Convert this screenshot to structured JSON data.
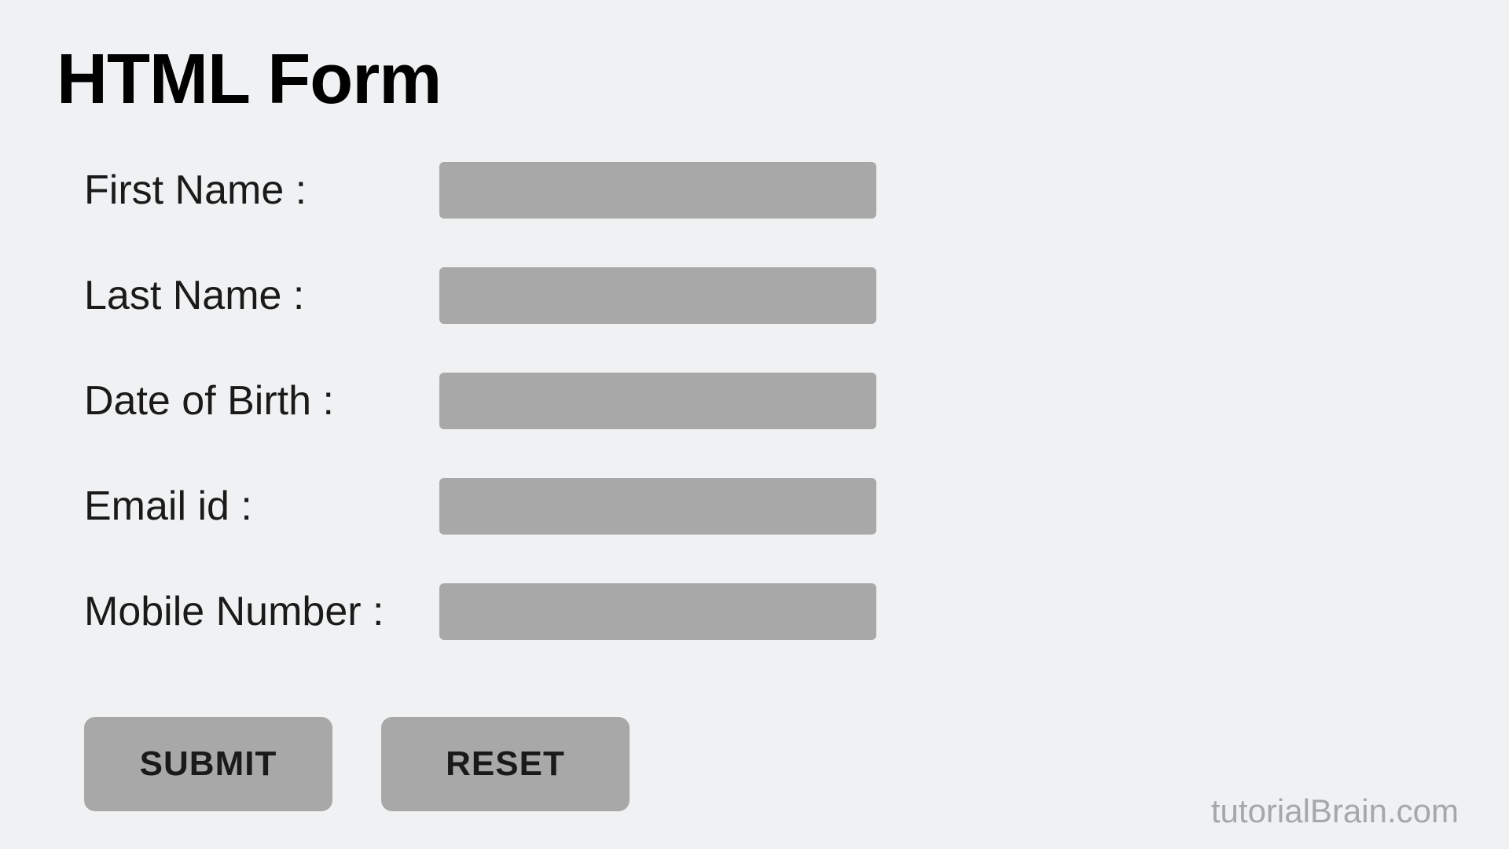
{
  "title": "HTML Form",
  "form": {
    "fields": [
      {
        "label": "First  Name :",
        "value": ""
      },
      {
        "label": "Last Name :",
        "value": ""
      },
      {
        "label": "Date of Birth :",
        "value": ""
      },
      {
        "label": "Email id :",
        "value": ""
      },
      {
        "label": "Mobile Number :",
        "value": ""
      }
    ]
  },
  "buttons": {
    "submit": "SUBMIT",
    "reset": "RESET"
  },
  "watermark": "tutorialBrain.com"
}
